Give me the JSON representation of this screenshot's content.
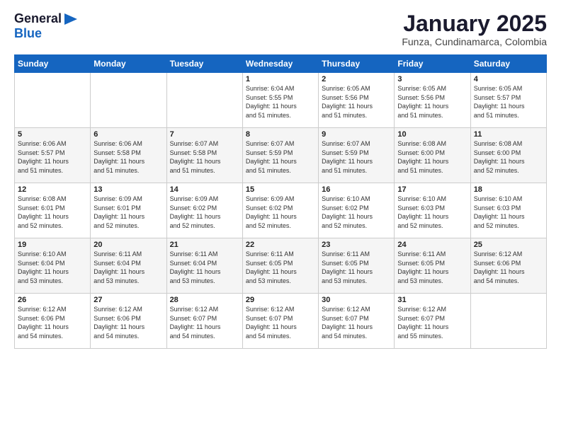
{
  "logo": {
    "general": "General",
    "blue": "Blue"
  },
  "header": {
    "month_year": "January 2025",
    "location": "Funza, Cundinamarca, Colombia"
  },
  "days_of_week": [
    "Sunday",
    "Monday",
    "Tuesday",
    "Wednesday",
    "Thursday",
    "Friday",
    "Saturday"
  ],
  "weeks": [
    [
      {
        "day": "",
        "info": ""
      },
      {
        "day": "",
        "info": ""
      },
      {
        "day": "",
        "info": ""
      },
      {
        "day": "1",
        "info": "Sunrise: 6:04 AM\nSunset: 5:55 PM\nDaylight: 11 hours\nand 51 minutes."
      },
      {
        "day": "2",
        "info": "Sunrise: 6:05 AM\nSunset: 5:56 PM\nDaylight: 11 hours\nand 51 minutes."
      },
      {
        "day": "3",
        "info": "Sunrise: 6:05 AM\nSunset: 5:56 PM\nDaylight: 11 hours\nand 51 minutes."
      },
      {
        "day": "4",
        "info": "Sunrise: 6:05 AM\nSunset: 5:57 PM\nDaylight: 11 hours\nand 51 minutes."
      }
    ],
    [
      {
        "day": "5",
        "info": "Sunrise: 6:06 AM\nSunset: 5:57 PM\nDaylight: 11 hours\nand 51 minutes."
      },
      {
        "day": "6",
        "info": "Sunrise: 6:06 AM\nSunset: 5:58 PM\nDaylight: 11 hours\nand 51 minutes."
      },
      {
        "day": "7",
        "info": "Sunrise: 6:07 AM\nSunset: 5:58 PM\nDaylight: 11 hours\nand 51 minutes."
      },
      {
        "day": "8",
        "info": "Sunrise: 6:07 AM\nSunset: 5:59 PM\nDaylight: 11 hours\nand 51 minutes."
      },
      {
        "day": "9",
        "info": "Sunrise: 6:07 AM\nSunset: 5:59 PM\nDaylight: 11 hours\nand 51 minutes."
      },
      {
        "day": "10",
        "info": "Sunrise: 6:08 AM\nSunset: 6:00 PM\nDaylight: 11 hours\nand 51 minutes."
      },
      {
        "day": "11",
        "info": "Sunrise: 6:08 AM\nSunset: 6:00 PM\nDaylight: 11 hours\nand 52 minutes."
      }
    ],
    [
      {
        "day": "12",
        "info": "Sunrise: 6:08 AM\nSunset: 6:01 PM\nDaylight: 11 hours\nand 52 minutes."
      },
      {
        "day": "13",
        "info": "Sunrise: 6:09 AM\nSunset: 6:01 PM\nDaylight: 11 hours\nand 52 minutes."
      },
      {
        "day": "14",
        "info": "Sunrise: 6:09 AM\nSunset: 6:02 PM\nDaylight: 11 hours\nand 52 minutes."
      },
      {
        "day": "15",
        "info": "Sunrise: 6:09 AM\nSunset: 6:02 PM\nDaylight: 11 hours\nand 52 minutes."
      },
      {
        "day": "16",
        "info": "Sunrise: 6:10 AM\nSunset: 6:02 PM\nDaylight: 11 hours\nand 52 minutes."
      },
      {
        "day": "17",
        "info": "Sunrise: 6:10 AM\nSunset: 6:03 PM\nDaylight: 11 hours\nand 52 minutes."
      },
      {
        "day": "18",
        "info": "Sunrise: 6:10 AM\nSunset: 6:03 PM\nDaylight: 11 hours\nand 52 minutes."
      }
    ],
    [
      {
        "day": "19",
        "info": "Sunrise: 6:10 AM\nSunset: 6:04 PM\nDaylight: 11 hours\nand 53 minutes."
      },
      {
        "day": "20",
        "info": "Sunrise: 6:11 AM\nSunset: 6:04 PM\nDaylight: 11 hours\nand 53 minutes."
      },
      {
        "day": "21",
        "info": "Sunrise: 6:11 AM\nSunset: 6:04 PM\nDaylight: 11 hours\nand 53 minutes."
      },
      {
        "day": "22",
        "info": "Sunrise: 6:11 AM\nSunset: 6:05 PM\nDaylight: 11 hours\nand 53 minutes."
      },
      {
        "day": "23",
        "info": "Sunrise: 6:11 AM\nSunset: 6:05 PM\nDaylight: 11 hours\nand 53 minutes."
      },
      {
        "day": "24",
        "info": "Sunrise: 6:11 AM\nSunset: 6:05 PM\nDaylight: 11 hours\nand 53 minutes."
      },
      {
        "day": "25",
        "info": "Sunrise: 6:12 AM\nSunset: 6:06 PM\nDaylight: 11 hours\nand 54 minutes."
      }
    ],
    [
      {
        "day": "26",
        "info": "Sunrise: 6:12 AM\nSunset: 6:06 PM\nDaylight: 11 hours\nand 54 minutes."
      },
      {
        "day": "27",
        "info": "Sunrise: 6:12 AM\nSunset: 6:06 PM\nDaylight: 11 hours\nand 54 minutes."
      },
      {
        "day": "28",
        "info": "Sunrise: 6:12 AM\nSunset: 6:07 PM\nDaylight: 11 hours\nand 54 minutes."
      },
      {
        "day": "29",
        "info": "Sunrise: 6:12 AM\nSunset: 6:07 PM\nDaylight: 11 hours\nand 54 minutes."
      },
      {
        "day": "30",
        "info": "Sunrise: 6:12 AM\nSunset: 6:07 PM\nDaylight: 11 hours\nand 54 minutes."
      },
      {
        "day": "31",
        "info": "Sunrise: 6:12 AM\nSunset: 6:07 PM\nDaylight: 11 hours\nand 55 minutes."
      },
      {
        "day": "",
        "info": ""
      }
    ]
  ]
}
